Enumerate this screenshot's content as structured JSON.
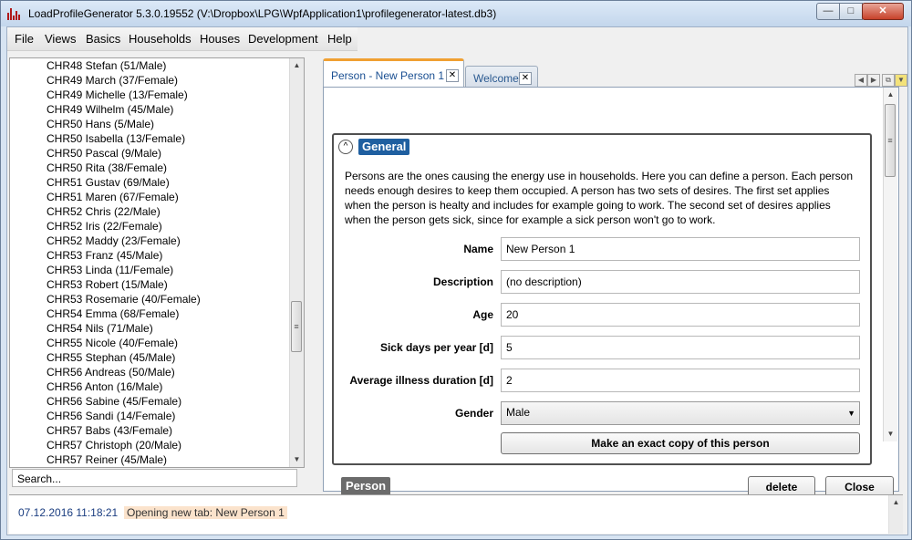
{
  "window": {
    "title": "LoadProfileGenerator 5.3.0.19552 (V:\\Dropbox\\LPG\\WpfApplication1\\profilegenerator-latest.db3)",
    "minimize_label": "—",
    "maximize_label": "□",
    "close_label": "✕"
  },
  "menu": [
    "File",
    "Views",
    "Basics",
    "Households",
    "Houses",
    "Development",
    "Help"
  ],
  "person_list": [
    "CHR48 Stefan (51/Male)",
    "CHR49 March (37/Female)",
    "CHR49 Michelle (13/Female)",
    "CHR49 Wilhelm (45/Male)",
    "CHR50 Hans (5/Male)",
    "CHR50 Isabella (13/Female)",
    "CHR50 Pascal (9/Male)",
    "CHR50 Rita (38/Female)",
    "CHR51 Gustav (69/Male)",
    "CHR51 Maren (67/Female)",
    "CHR52 Chris (22/Male)",
    "CHR52 Iris (22/Female)",
    "CHR52 Maddy (23/Female)",
    "CHR53 Franz (45/Male)",
    "CHR53 Linda (11/Female)",
    "CHR53 Robert (15/Male)",
    "CHR53 Rosemarie (40/Female)",
    "CHR54 Emma (68/Female)",
    "CHR54 Nils (71/Male)",
    "CHR55 Nicole (40/Female)",
    "CHR55 Stephan (45/Male)",
    "CHR56 Andreas (50/Male)",
    "CHR56 Anton (16/Male)",
    "CHR56 Sabine (45/Female)",
    "CHR56 Sandi (14/Female)",
    "CHR57 Babs (43/Female)",
    "CHR57 Christoph (20/Male)",
    "CHR57 Reiner (45/Male)"
  ],
  "search_placeholder": "Search...",
  "tabs": [
    {
      "label": "Person - New Person 1",
      "active": true
    },
    {
      "label": "Welcome",
      "active": false
    }
  ],
  "general": {
    "header": "General",
    "description": "Persons are the ones causing the energy use in households. Here you can define a person. Each person needs enough desires to keep them occupied. A person has two sets of desires. The first set applies when the person is healty and includes for example going to work. The second set of desires applies when the person gets sick, since for example a sick person won't go to work.",
    "fields": {
      "name": {
        "label": "Name",
        "value": "New Person 1"
      },
      "description": {
        "label": "Description",
        "value": "(no description)"
      },
      "age": {
        "label": "Age",
        "value": "20"
      },
      "sick_days": {
        "label": "Sick days per year [d]",
        "value": "5"
      },
      "illness_duration": {
        "label": "Average illness duration [d]",
        "value": "2"
      },
      "gender": {
        "label": "Gender",
        "value": "Male"
      }
    },
    "copy_button": "Make an exact copy of this person"
  },
  "footer": {
    "tag": "Person",
    "delete_label": "delete",
    "close_label": "Close"
  },
  "log": [
    {
      "time": "07.12.2016 11:18:21",
      "message": "Opening new tab: New Person 1"
    }
  ],
  "colors": {
    "accent": "#1f5fa0",
    "tab_highlight": "#f0a032",
    "log_highlight": "#fbe3cc"
  }
}
